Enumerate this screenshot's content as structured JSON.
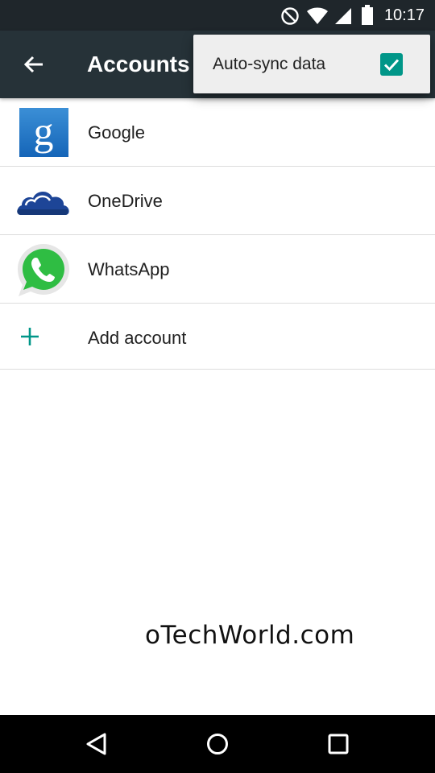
{
  "status_bar": {
    "time": "10:17",
    "icons": [
      "do-not-disturb-icon",
      "wifi-icon",
      "signal-icon",
      "battery-icon"
    ]
  },
  "app_bar": {
    "title": "Accounts",
    "background": "#263238",
    "back_icon": "arrow-back-icon"
  },
  "overflow_menu": {
    "items": [
      {
        "label": "Auto-sync data",
        "checked": true
      }
    ],
    "checkbox_color": "#009688"
  },
  "accounts": [
    {
      "label": "Google",
      "icon": "google-icon"
    },
    {
      "label": "OneDrive",
      "icon": "onedrive-icon"
    },
    {
      "label": "WhatsApp",
      "icon": "whatsapp-icon"
    }
  ],
  "add_account": {
    "label": "Add account",
    "icon": "plus-icon",
    "icon_color": "#009688"
  },
  "watermark": "oTechWorld.com",
  "nav_bar": {
    "buttons": [
      "back-triangle-icon",
      "home-circle-icon",
      "recents-square-icon"
    ]
  }
}
